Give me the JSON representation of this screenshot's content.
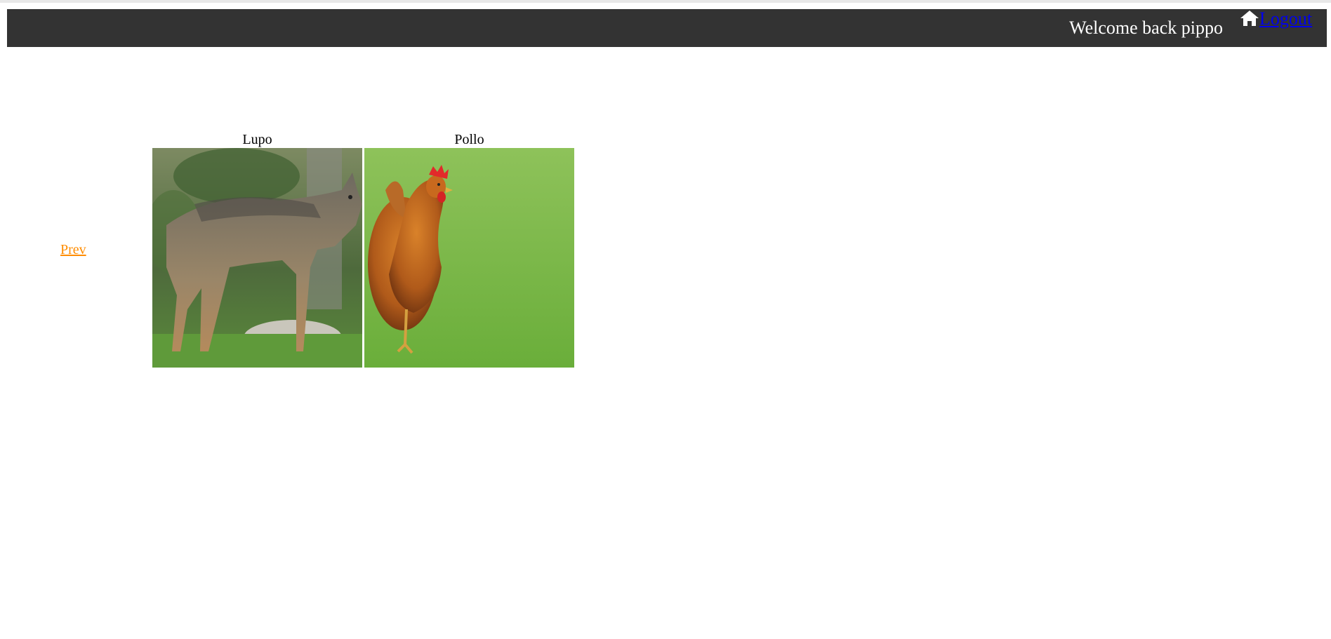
{
  "header": {
    "welcome_text": "Welcome back pippo",
    "home_icon": "home-icon",
    "logout_label": "Logout"
  },
  "pagination": {
    "prev_label": "Prev"
  },
  "gallery": {
    "items": [
      {
        "caption": "Lupo",
        "image": "wolf photo"
      },
      {
        "caption": "Pollo",
        "image": "chicken photo"
      }
    ]
  },
  "colors": {
    "navbar": "#333333",
    "prev_link": "#ff8c00",
    "logout_link": "#0000ee"
  }
}
